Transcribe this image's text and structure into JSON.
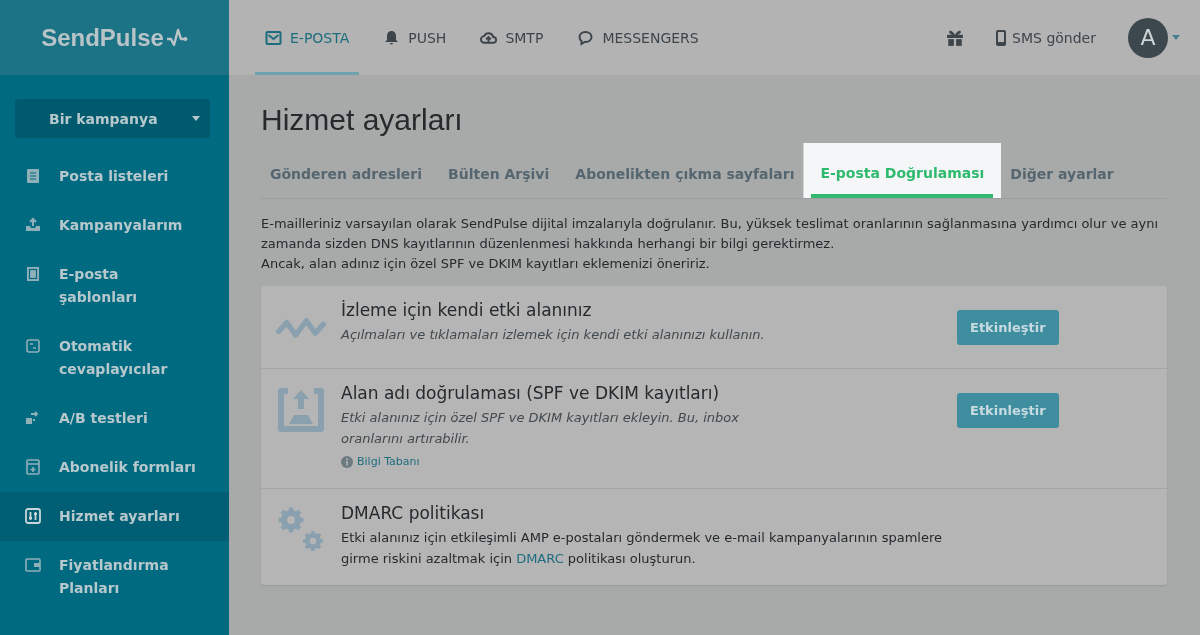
{
  "logo": "SendPulse",
  "top_nav": [
    {
      "label": "E-POSTA",
      "kind": "envelope",
      "selected": true
    },
    {
      "label": "PUSH",
      "kind": "bell",
      "selected": false
    },
    {
      "label": "SMTP",
      "kind": "cloud",
      "selected": false
    },
    {
      "label": "MESSENGERS",
      "kind": "chat",
      "selected": false
    }
  ],
  "sms_button": "SMS gönder",
  "avatar": "A",
  "campaign_button": "Bir kampanya",
  "sidebar": {
    "items": [
      {
        "label": "Posta listeleri",
        "kind": "list",
        "selected": false
      },
      {
        "label": "Kampanyalarım",
        "kind": "upload",
        "selected": false
      },
      {
        "label": "E-posta şablonları",
        "kind": "template",
        "selected": false
      },
      {
        "label": "Otomatik cevaplayıcılar",
        "kind": "auto",
        "selected": false
      },
      {
        "label": "A/B testleri",
        "kind": "ab",
        "selected": false
      },
      {
        "label": "Abonelik formları",
        "kind": "form",
        "selected": false
      },
      {
        "label": "Hizmet ayarları",
        "kind": "sliders",
        "selected": true
      },
      {
        "label": "Fiyatlandırma Planları",
        "kind": "wallet",
        "selected": false
      }
    ]
  },
  "page_title": "Hizmet ayarları",
  "tabs": [
    {
      "label": "Gönderen adresleri",
      "selected": false
    },
    {
      "label": "Bülten Arşivi",
      "selected": false
    },
    {
      "label": "Abonelikten çıkma sayfaları",
      "selected": false
    },
    {
      "label": "E-posta Doğrulaması",
      "selected": true
    },
    {
      "label": "Diğer ayarlar",
      "selected": false
    }
  ],
  "intro": [
    "E-mailleriniz varsayılan olarak SendPulse dijital imzalarıyla doğrulanır. Bu, yüksek teslimat oranlarının sağlanmasına yardımcı olur ve aynı zamanda sizden DNS kayıtlarının düzenlenmesi hakkında herhangi bir bilgi gerektirmez.",
    "Ancak, alan adınız için özel SPF ve DKIM kayıtları eklemenizi öneririz."
  ],
  "features": [
    {
      "kind": "tracking",
      "title": "İzleme için kendi etki alanınız",
      "description": "Açılmaları ve tıklamaları izlemek için kendi etki alanınızı kullanın.",
      "button": "Etkinleştir"
    },
    {
      "kind": "domain",
      "title": "Alan adı doğrulaması (SPF ve DKIM kayıtları)",
      "description": "Etki alanınız için özel SPF ve DKIM kayıtları ekleyin. Bu, inbox oranlarını artırabilir.",
      "link": "Bilgi Tabanı",
      "button": "Etkinleştir"
    },
    {
      "kind": "dmarc",
      "title": "DMARC politikası",
      "text_before": "Etki alanınız için etkileşimli AMP e-postaları göndermek ve e-mail kampanyalarının spamlere girme riskini azaltmak için ",
      "inline_link": "DMARC",
      "text_after": " politikası oluşturun."
    }
  ]
}
